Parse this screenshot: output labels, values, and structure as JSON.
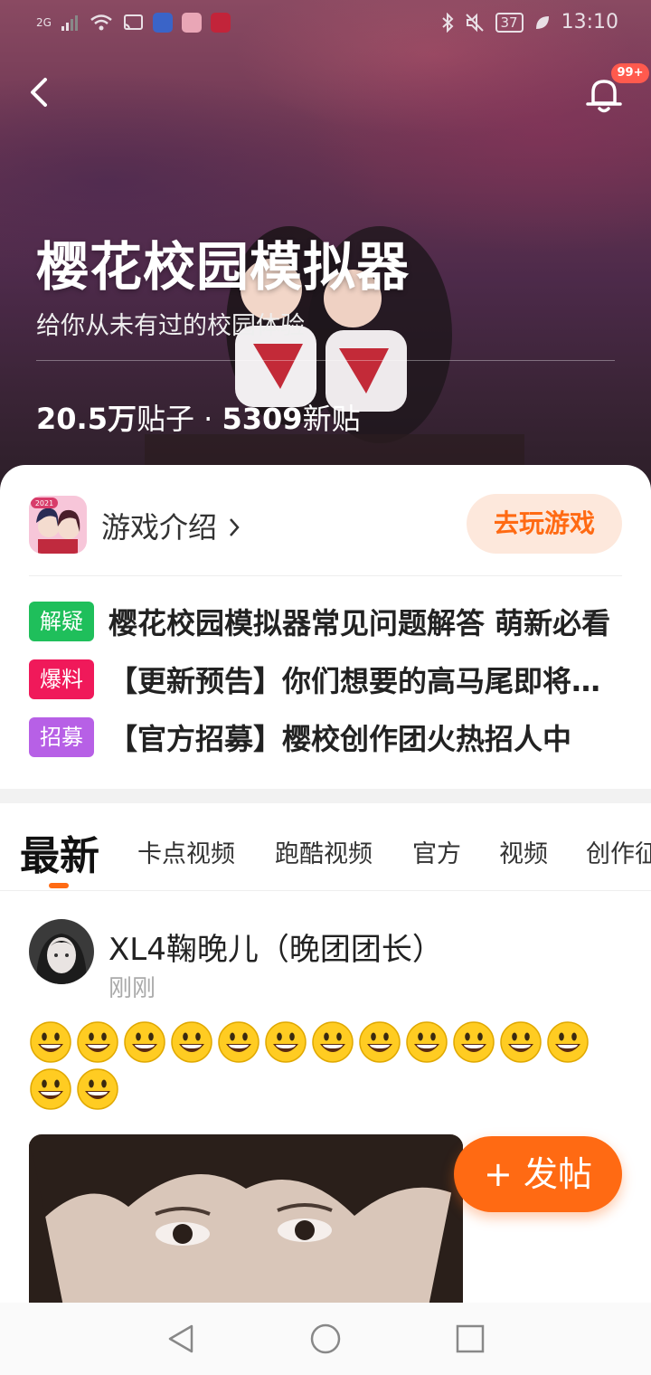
{
  "status_bar": {
    "network": "2G",
    "battery": "37",
    "time": "13:10"
  },
  "notifications": {
    "badge": "99+"
  },
  "forum": {
    "title": "樱花校园模拟器",
    "subtitle": "给你从未有过的校园体验",
    "posts_count": "20.5万",
    "posts_label": "贴子",
    "separator": " · ",
    "new_count": "5309",
    "new_label": "新贴"
  },
  "game_card": {
    "icon_text": "2021",
    "intro_label": "游戏介绍",
    "play_label": "去玩游戏"
  },
  "pinned": [
    {
      "tag": "解疑",
      "tag_color": "#1fbf5b",
      "title": "樱花校园模拟器常见问题解答 萌新必看"
    },
    {
      "tag": "爆料",
      "tag_color": "#f0195a",
      "title": "【更新预告】你们想要的高马尾即将上线"
    },
    {
      "tag": "招募",
      "tag_color": "#b760e6",
      "title": "【官方招募】樱校创作团火热招人中"
    }
  ],
  "tabs": [
    "最新",
    "卡点视频",
    "跑酷视频",
    "官方",
    "视频",
    "创作征"
  ],
  "post": {
    "author": "XL4鞠晚儿（晚团团长）",
    "time": "刚刚",
    "emoji_count": 14
  },
  "fab_label": "+ 发帖",
  "colors": {
    "accent": "#ff6a13",
    "accent_light": "#fde8dc"
  },
  "icons": [
    "back-icon",
    "bell-icon",
    "chevron-right-icon",
    "grinning-face-icon",
    "nav-back-icon",
    "nav-home-icon",
    "nav-recent-icon"
  ]
}
